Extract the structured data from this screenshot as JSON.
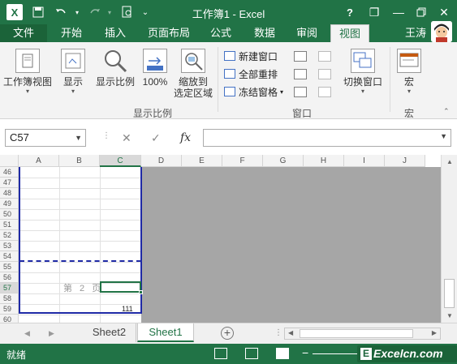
{
  "titlebar": {
    "title": "工作簿1 - Excel",
    "app_logo": "X",
    "help": "?",
    "minimize": "—",
    "restore": "❐",
    "close": "✕"
  },
  "tabs": {
    "file": "文件",
    "items": [
      "开始",
      "插入",
      "页面布局",
      "公式",
      "数据",
      "审阅",
      "视图"
    ],
    "active": "视图",
    "user": "王涛"
  },
  "ribbon": {
    "workbook_views": "工作簿视图",
    "show": "显示",
    "zoom": "显示比例",
    "zoom100": "100%",
    "zoom_to_selection_1": "缩放到",
    "zoom_to_selection_2": "选定区域",
    "zoom_group": "显示比例",
    "new_window": "新建窗口",
    "arrange_all": "全部重排",
    "freeze_panes": "冻结窗格",
    "window_group": "窗口",
    "switch_windows": "切换窗口",
    "macros": "宏",
    "macros_group": "宏"
  },
  "formula_bar": {
    "name_box": "C57",
    "cancel": "✕",
    "enter": "✓",
    "fx": "fx",
    "value": ""
  },
  "sheet": {
    "columns": [
      "A",
      "B",
      "C",
      "D",
      "E",
      "F",
      "G",
      "H",
      "I",
      "J"
    ],
    "selected_column": "C",
    "rows": [
      "46",
      "47",
      "48",
      "49",
      "50",
      "51",
      "52",
      "53",
      "54",
      "55",
      "56",
      "57",
      "58",
      "59",
      "60"
    ],
    "selected_row": "57",
    "page_label": "第 2 页",
    "cell_value": "111"
  },
  "sheet_tabs": {
    "tabs": [
      "Sheet2",
      "Sheet1"
    ],
    "active": "Sheet1",
    "add": "+"
  },
  "statusbar": {
    "status": "就绪",
    "zoom_minus": "−",
    "watermark": "Excelcn.com",
    "watermark_e": "E"
  }
}
